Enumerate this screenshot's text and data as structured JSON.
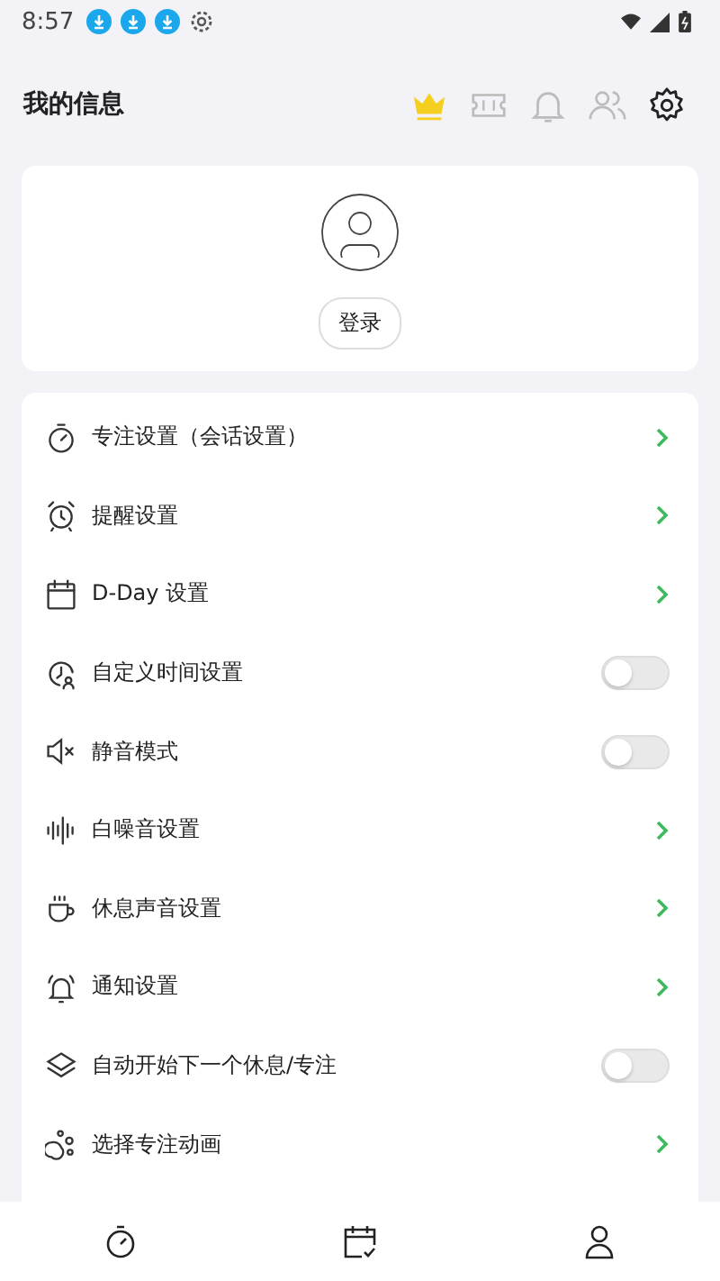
{
  "status_bar": {
    "time": "8:57"
  },
  "header": {
    "title": "我的信息"
  },
  "profile": {
    "login_button": "登录"
  },
  "settings": [
    {
      "label": "专注设置（会话设置）",
      "kind": "link"
    },
    {
      "label": "提醒设置",
      "kind": "link"
    },
    {
      "label": "D-Day 设置",
      "kind": "link"
    },
    {
      "label": "自定义时间设置",
      "kind": "toggle",
      "on": false
    },
    {
      "label": "静音模式",
      "kind": "toggle",
      "on": false
    },
    {
      "label": "白噪音设置",
      "kind": "link"
    },
    {
      "label": "休息声音设置",
      "kind": "link"
    },
    {
      "label": "通知设置",
      "kind": "link"
    },
    {
      "label": "自动开始下一个休息/专注",
      "kind": "toggle",
      "on": false
    },
    {
      "label": "选择专注动画",
      "kind": "link"
    }
  ]
}
